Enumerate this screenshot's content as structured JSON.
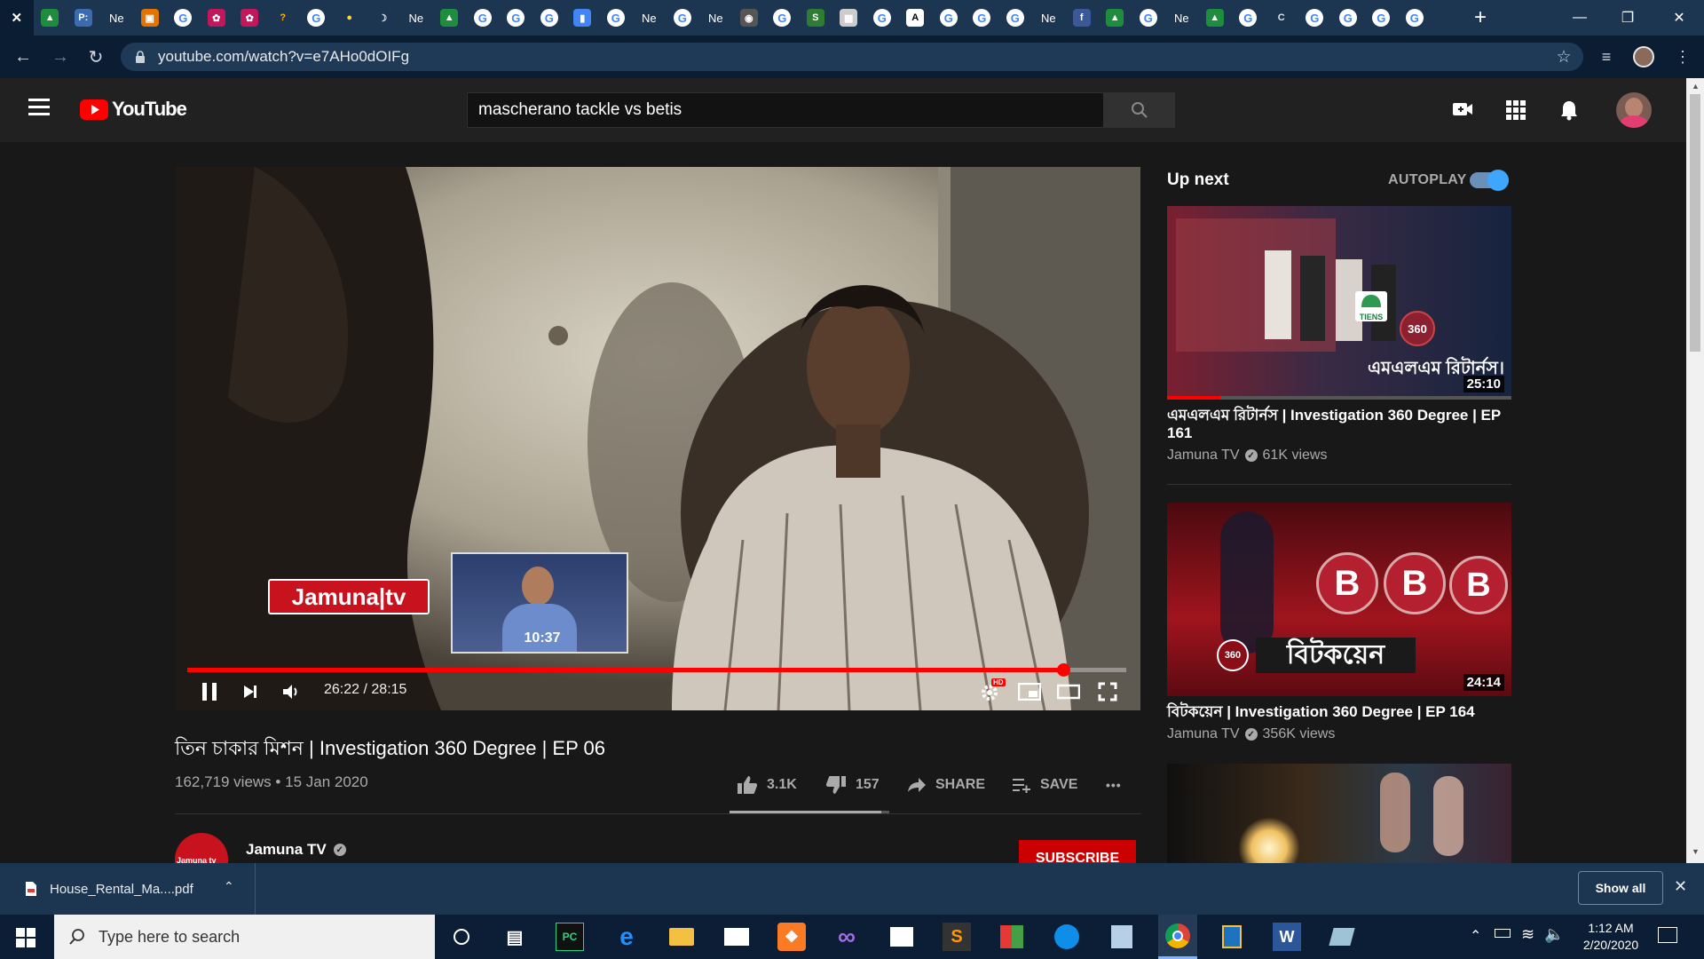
{
  "browser": {
    "tabs": [
      {
        "icon": "close-x",
        "label": "✕",
        "bg": "transparent"
      },
      {
        "icon": "google-drive-icon",
        "label": "▲",
        "bg": "#1e8e3e"
      },
      {
        "icon": "pycharm-doc-icon",
        "label": "P:",
        "bg": "#3c6cb0"
      },
      {
        "icon": "ne-text",
        "label": "Ne",
        "bg": "transparent"
      },
      {
        "icon": "presentation-icon",
        "label": "▣",
        "bg": "#e37400"
      },
      {
        "icon": "google-icon",
        "label": "G",
        "bg": "#fff"
      },
      {
        "icon": "app-icon",
        "label": "✿",
        "bg": "#c2185b"
      },
      {
        "icon": "app-icon",
        "label": "✿",
        "bg": "#c2185b"
      },
      {
        "icon": "hook-icon",
        "label": "?",
        "bg": "transparent"
      },
      {
        "icon": "google-icon",
        "label": "G",
        "bg": "#fff"
      },
      {
        "icon": "bulb-icon",
        "label": "●",
        "bg": "transparent"
      },
      {
        "icon": "moon-icon",
        "label": "☽",
        "bg": "transparent"
      },
      {
        "icon": "ne-text",
        "label": "Ne",
        "bg": "transparent"
      },
      {
        "icon": "google-drive-icon",
        "label": "▲",
        "bg": "#1e8e3e"
      },
      {
        "icon": "google-icon",
        "label": "G",
        "bg": "#fff"
      },
      {
        "icon": "google-icon",
        "label": "G",
        "bg": "#fff"
      },
      {
        "icon": "google-icon",
        "label": "G",
        "bg": "#fff"
      },
      {
        "icon": "doc-icon",
        "label": "▮",
        "bg": "#4285f4"
      },
      {
        "icon": "google-icon",
        "label": "G",
        "bg": "#fff"
      },
      {
        "icon": "ne-text",
        "label": "Ne",
        "bg": "transparent"
      },
      {
        "icon": "google-icon",
        "label": "G",
        "bg": "#fff"
      },
      {
        "icon": "ne-text",
        "label": "Ne",
        "bg": "transparent"
      },
      {
        "icon": "globe-icon",
        "label": "◉",
        "bg": "#555"
      },
      {
        "icon": "google-icon",
        "label": "G",
        "bg": "#fff"
      },
      {
        "icon": "s-icon",
        "label": "S",
        "bg": "#2e7d32"
      },
      {
        "icon": "image-icon",
        "label": "▦",
        "bg": "#ccc"
      },
      {
        "icon": "google-icon",
        "label": "G",
        "bg": "#fff"
      },
      {
        "icon": "a-icon",
        "label": "A",
        "bg": "#fff"
      },
      {
        "icon": "google-icon",
        "label": "G",
        "bg": "#fff"
      },
      {
        "icon": "google-icon",
        "label": "G",
        "bg": "#fff"
      },
      {
        "icon": "google-icon",
        "label": "G",
        "bg": "#fff"
      },
      {
        "icon": "ne-text",
        "label": "Ne",
        "bg": "transparent"
      },
      {
        "icon": "facebook-icon",
        "label": "f",
        "bg": "#3b5998"
      },
      {
        "icon": "google-drive-icon",
        "label": "▲",
        "bg": "#1e8e3e"
      },
      {
        "icon": "google-icon",
        "label": "G",
        "bg": "#fff"
      },
      {
        "icon": "ne-text",
        "label": "Ne",
        "bg": "transparent"
      },
      {
        "icon": "google-drive-icon",
        "label": "▲",
        "bg": "#1e8e3e"
      },
      {
        "icon": "google-icon",
        "label": "G",
        "bg": "#fff"
      },
      {
        "icon": "loading-icon",
        "label": "C",
        "bg": "transparent"
      },
      {
        "icon": "google-icon",
        "label": "G",
        "bg": "#fff"
      },
      {
        "icon": "google-icon",
        "label": "G",
        "bg": "#fff"
      },
      {
        "icon": "google-icon",
        "label": "G",
        "bg": "#fff"
      },
      {
        "icon": "google-icon",
        "label": "G",
        "bg": "#fff"
      }
    ],
    "url": "youtube.com/watch?v=e7AHo0dOIFg"
  },
  "youtube": {
    "logo_text": "YouTube",
    "search_value": "mascherano tackle vs betis"
  },
  "player": {
    "overlay_logo": "Jamuna|tv",
    "progress_fraction": 0.933,
    "preview_time": "10:37",
    "current_time": "26:22",
    "separator": "/",
    "duration": "28:15",
    "hd_badge": "HD"
  },
  "video": {
    "title": "তিন চাকার মিশন | Investigation 360 Degree | EP 06",
    "views": "162,719 views",
    "dot": "•",
    "date": "15 Jan 2020",
    "likes": "3.1K",
    "dislikes": "157",
    "share_label": "SHARE",
    "save_label": "SAVE",
    "more_label": "•••",
    "channel": "Jamuna TV",
    "avatar_text": "Jamuna tv",
    "subscribe_label": "SUBSCRIBE"
  },
  "upnext": {
    "label": "Up next",
    "autoplay_label": "AUTOPLAY",
    "autoplay_on": true,
    "items": [
      {
        "title": "এমএলএম রিটার্নস | Investigation 360 Degree | EP 161",
        "channel": "Jamuna TV",
        "views": "61K views",
        "duration": "25:10",
        "thumb_text": "এমএলএম রিটার্নস।",
        "thumb_logo": "TIENS",
        "thumb_badge": "360"
      },
      {
        "title": "বিটকয়েন | Investigation 360 Degree | EP 164",
        "channel": "Jamuna TV",
        "views": "356K views",
        "duration": "24:14",
        "thumb_text": "বিটকয়েন",
        "thumb_badge": "360"
      }
    ]
  },
  "download": {
    "filename": "House_Rental_Ma....pdf",
    "show_all": "Show all"
  },
  "taskbar": {
    "search_placeholder": "Type here to search",
    "time": "1:12 AM",
    "date": "2/20/2020"
  },
  "colors": {
    "youtube_red": "#ff0000",
    "subscribe_red": "#cc0000",
    "autoplay_blue": "#3ea6ff",
    "chrome_frame": "#1c3550"
  }
}
